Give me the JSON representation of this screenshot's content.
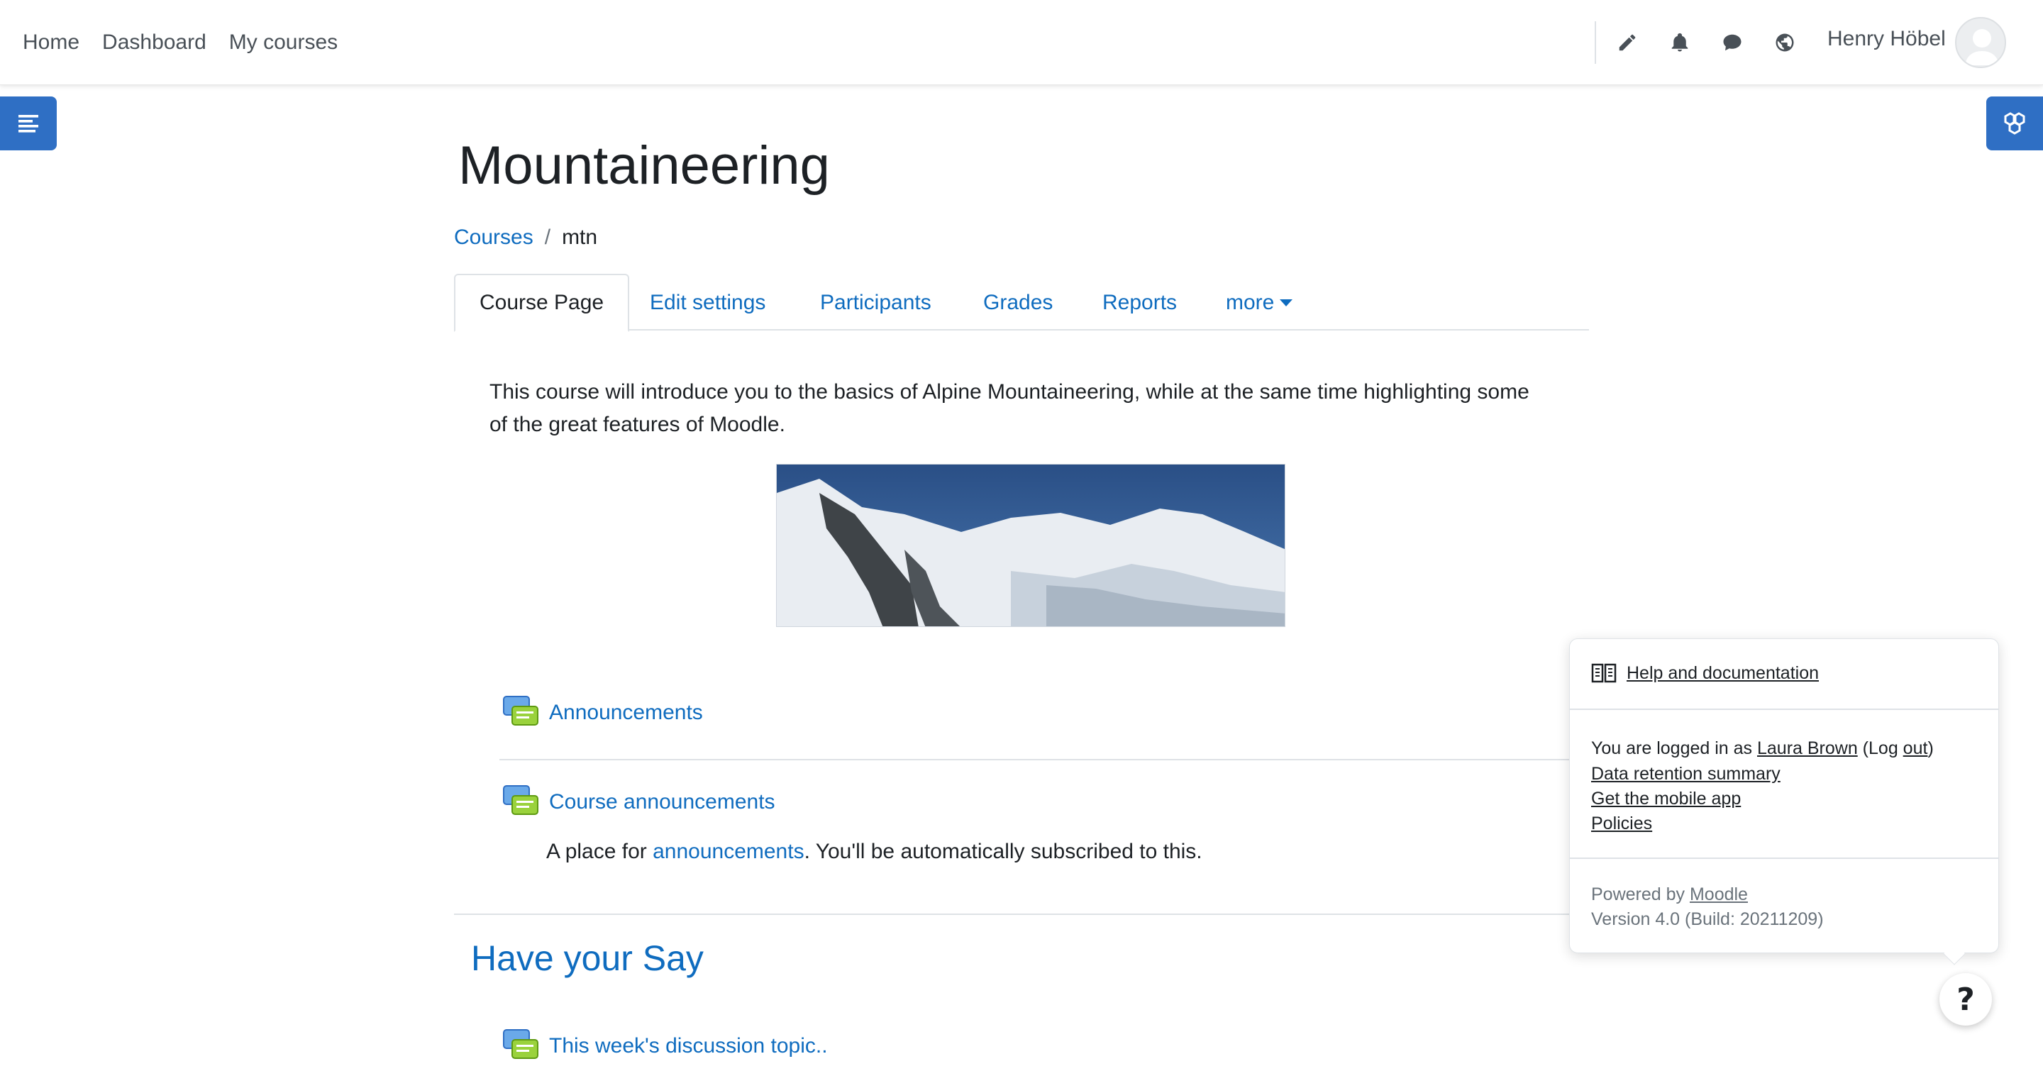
{
  "navbar": {
    "links": [
      "Home",
      "Dashboard",
      "My courses"
    ],
    "user_name": "Henry Höbel",
    "icons": [
      "pencil-icon",
      "bell-icon",
      "chat-icon",
      "globe-icon"
    ]
  },
  "course": {
    "title": "Mountaineering",
    "breadcrumb": {
      "parent": "Courses",
      "separator": "/",
      "current": "mtn"
    },
    "tabs": [
      "Course Page",
      "Edit settings",
      "Participants",
      "Grades",
      "Reports",
      "more"
    ],
    "intro_line1": "This course will introduce you to the basics of Alpine Mountaineering, while at the same time highlighting some",
    "intro_line2": "of the great features of Moodle.",
    "activities": {
      "announcements": "Announcements",
      "course_announcements": "Course announcements",
      "desc_prefix": "A place for ",
      "desc_link": "announcements",
      "desc_suffix": ". You'll be automatically subscribed to this."
    },
    "section_title": "Have your Say",
    "discussion_topic": "This week's discussion topic.."
  },
  "footer": {
    "help_link": "Help and documentation",
    "logged_in_prefix": "You are logged in as ",
    "logged_in_user": "Laura Brown",
    "logout_open": " (Log ",
    "logout_link": "out",
    "logout_close": ")",
    "data_retention": "Data retention summary",
    "mobile_app": "Get the mobile app",
    "policies": "Policies",
    "powered_by_prefix": "Powered by ",
    "powered_by_link": "Moodle",
    "version": "Version 4.0 (Build: 20211209)",
    "help_button": "?"
  },
  "colors": {
    "accent": "#0f6cbf",
    "drawer": "#2f6fc4",
    "text": "#1d2125",
    "muted": "#6a737b"
  }
}
